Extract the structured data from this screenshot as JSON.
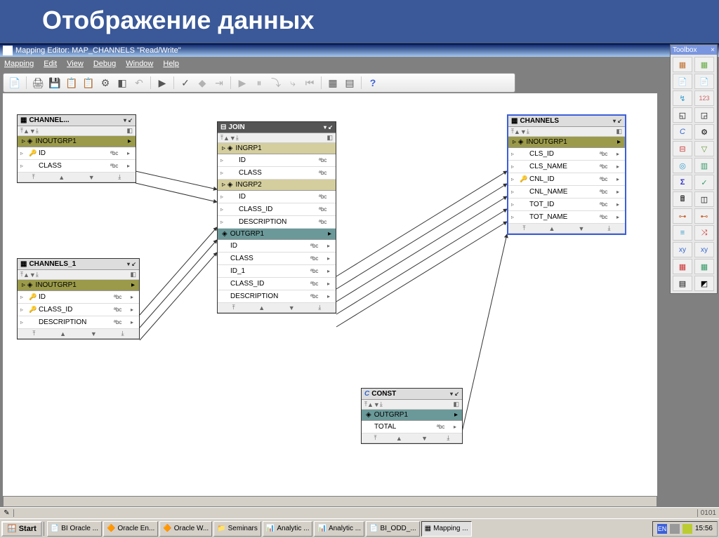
{
  "slide": {
    "title": "Отображение данных"
  },
  "window": {
    "title": "Mapping Editor: MAP_CHANNELS \"Read/Write\"",
    "controls": {
      "min": "_",
      "max": "❐",
      "close": "×"
    }
  },
  "menu": {
    "items": [
      "Mapping",
      "Edit",
      "View",
      "Debug",
      "Window",
      "Help"
    ]
  },
  "toolbar_help_icon": "?",
  "toolbox": {
    "title": "Toolbox",
    "close": "×"
  },
  "status": {
    "edit_icon": "✎",
    "ratio": "0101"
  },
  "nodes": {
    "channel_src": {
      "title": "CHANNEL...",
      "group": "INOUTGRP1",
      "fields": [
        {
          "key": "🔑",
          "name": "ID",
          "type": "ªbc"
        },
        {
          "key": "",
          "name": "CLASS",
          "type": "ªbc"
        }
      ]
    },
    "channels_1": {
      "title": "CHANNELS_1",
      "group": "INOUTGRP1",
      "fields": [
        {
          "key": "🔑",
          "name": "ID",
          "type": "ªbc"
        },
        {
          "key": "🔑",
          "name": "CLASS_ID",
          "type": "ªbc"
        },
        {
          "key": "",
          "name": "DESCRIPTION",
          "type": "ªbc"
        }
      ]
    },
    "join": {
      "title": "JOIN",
      "ingrp1": {
        "label": "INGRP1",
        "fields": [
          {
            "name": "ID",
            "type": "ªbc"
          },
          {
            "name": "CLASS",
            "type": "ªbc"
          }
        ]
      },
      "ingrp2": {
        "label": "INGRP2",
        "fields": [
          {
            "name": "ID",
            "type": "ªbc"
          },
          {
            "name": "CLASS_ID",
            "type": "ªbc"
          },
          {
            "name": "DESCRIPTION",
            "type": "ªbc"
          }
        ]
      },
      "outgrp": {
        "label": "OUTGRP1",
        "fields": [
          {
            "name": "ID",
            "type": "ªbc"
          },
          {
            "name": "CLASS",
            "type": "ªbc"
          },
          {
            "name": "ID_1",
            "type": "ªbc"
          },
          {
            "name": "CLASS_ID",
            "type": "ªbc"
          },
          {
            "name": "DESCRIPTION",
            "type": "ªbc"
          }
        ]
      }
    },
    "const": {
      "title": "CONST",
      "group": "OUTGRP1",
      "fields": [
        {
          "name": "TOTAL",
          "type": "ªbc"
        }
      ]
    },
    "channels_tgt": {
      "title": "CHANNELS",
      "group": "INOUTGRP1",
      "fields": [
        {
          "key": "",
          "name": "CLS_ID",
          "type": "ªbc"
        },
        {
          "key": "",
          "name": "CLS_NAME",
          "type": "ªbc"
        },
        {
          "key": "🔑",
          "name": "CNL_ID",
          "type": "ªbc"
        },
        {
          "key": "",
          "name": "CNL_NAME",
          "type": "ªbc"
        },
        {
          "key": "",
          "name": "TOT_ID",
          "type": "ªbc"
        },
        {
          "key": "",
          "name": "TOT_NAME",
          "type": "ªbc"
        }
      ]
    }
  },
  "taskbar": {
    "start": "Start",
    "items": [
      "BI Oracle ...",
      "Oracle En...",
      "Oracle W...",
      "Seminars",
      "Analytic ...",
      "Analytic ...",
      "BI_ODD_...",
      "Mapping ..."
    ],
    "lang": "EN",
    "time": "15:56"
  }
}
